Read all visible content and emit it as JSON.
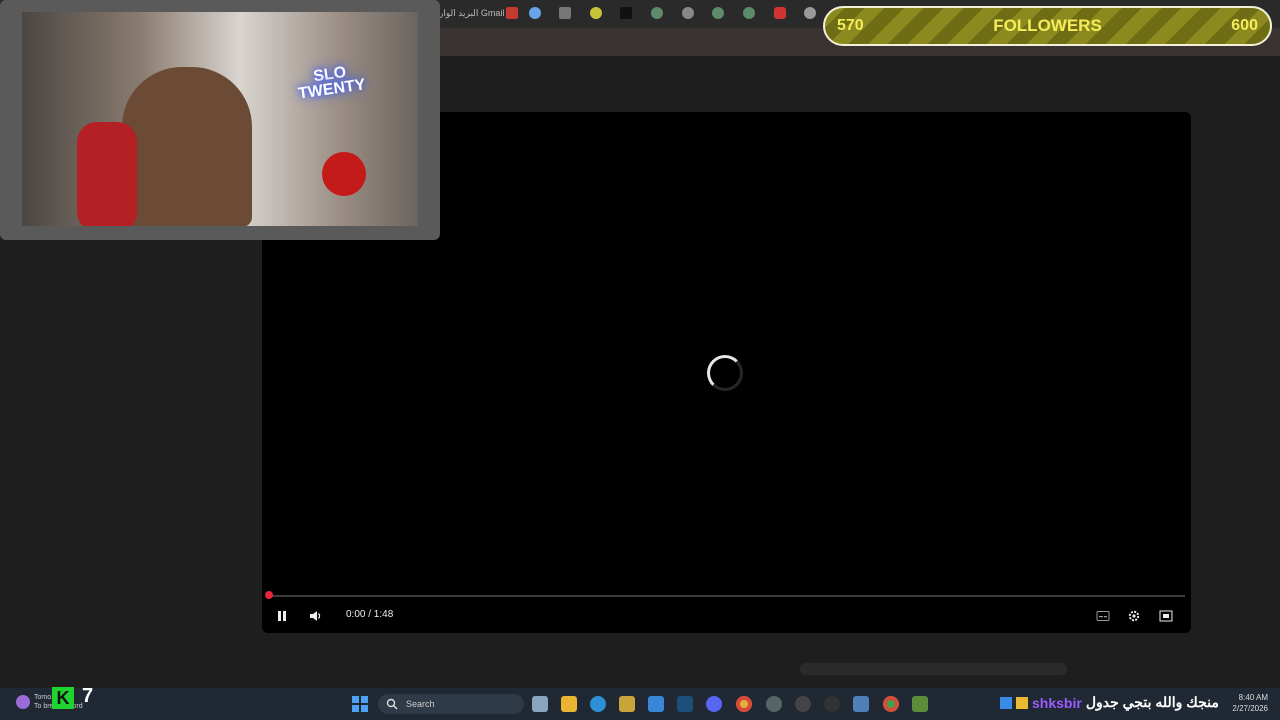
{
  "bookmarks": {
    "gmail_label": "البريد الوارد Gmail"
  },
  "follower_goal": {
    "current": "570",
    "label": "FOLLOWERS",
    "target": "600"
  },
  "webcam": {
    "neon_line1": "SLO",
    "neon_line2": "TWENTY"
  },
  "player": {
    "time": "0:00 / 1:48",
    "progress": 0
  },
  "taskbar": {
    "search_placeholder": "Search",
    "clock_time": "8:40 AM",
    "clock_date": "2/27/2026"
  },
  "stream_overlay": {
    "k_letter": "K",
    "counter": "7",
    "small_line1": "Tomo... hi",
    "small_line2": "To break record",
    "chat_user": "shksbir",
    "chat_message": "منجك والله بتجي جدول"
  },
  "colors": {
    "progress_red": "#e8263b",
    "goal_text": "#f5ec5a",
    "chat_user": "#9c5cff"
  }
}
